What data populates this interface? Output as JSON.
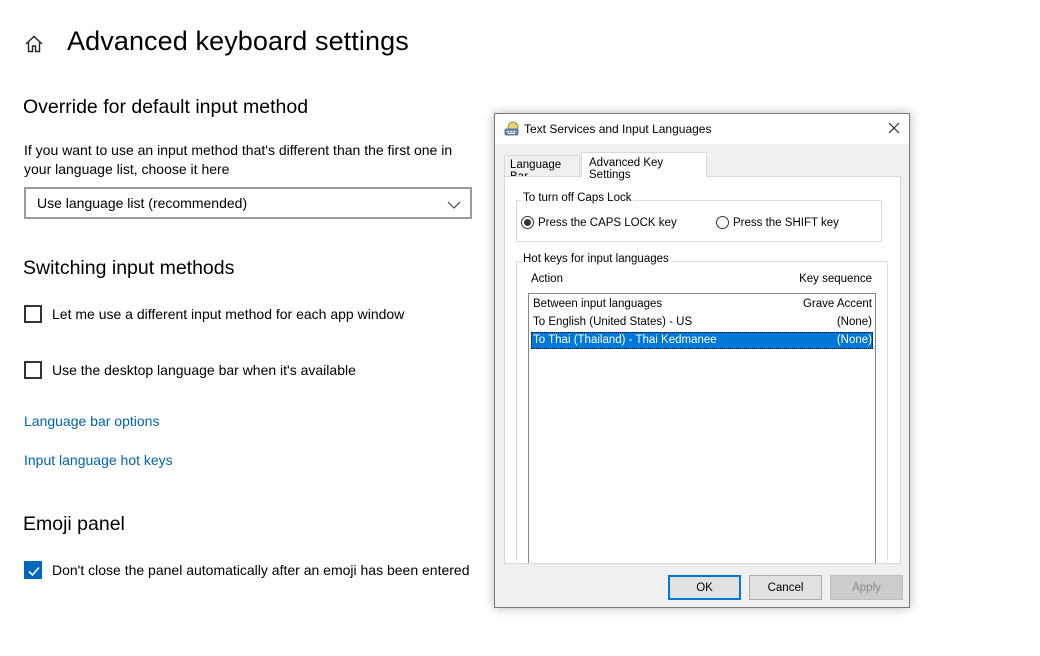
{
  "page": {
    "title": "Advanced keyboard settings",
    "home_icon": "home-icon"
  },
  "override": {
    "heading": "Override for default input method",
    "description": "If you want to use an input method that's different than the first one in your language list, choose it here",
    "dropdown_value": "Use language list (recommended)"
  },
  "switching": {
    "heading": "Switching input methods",
    "per_app_label": "Let me use a different input method for each app window",
    "per_app_checked": false,
    "desktop_bar_label": "Use the desktop language bar when it's available",
    "desktop_bar_checked": false,
    "link_language_bar": "Language bar options",
    "link_hot_keys": "Input language hot keys"
  },
  "emoji": {
    "heading": "Emoji panel",
    "keep_open_label": "Don't close the panel automatically after an emoji has been entered",
    "keep_open_checked": true
  },
  "dialog": {
    "title": "Text Services and Input Languages",
    "tabs": [
      "Language Bar",
      "Advanced Key Settings"
    ],
    "active_tab": "Advanced Key Settings",
    "caps_group": {
      "caption": "To turn off Caps Lock",
      "option_caps": "Press the CAPS LOCK key",
      "option_shift": "Press the SHIFT key",
      "selected": "Press the CAPS LOCK key"
    },
    "hotkeys_group": {
      "caption": "Hot keys for input languages",
      "col_action": "Action",
      "col_key": "Key sequence",
      "rows": [
        {
          "action": "Between input languages",
          "key": "Grave Accent",
          "selected": false
        },
        {
          "action": "To English (United States) - US",
          "key": "(None)",
          "selected": false
        },
        {
          "action": "To Thai (Thailand) - Thai Kedmanee",
          "key": "(None)",
          "selected": true
        }
      ]
    },
    "buttons": {
      "ok": "OK",
      "cancel": "Cancel",
      "apply": "Apply"
    }
  },
  "colors": {
    "accent": "#0067c0",
    "link": "#0063b1",
    "selection": "#0078d7"
  }
}
